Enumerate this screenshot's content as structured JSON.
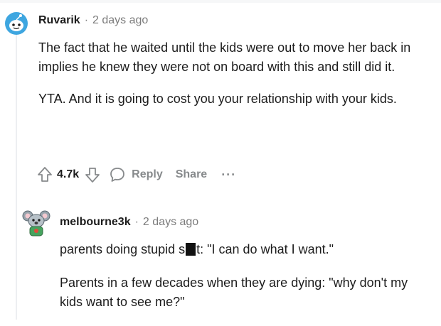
{
  "comments": [
    {
      "username": "Ruvarik",
      "timestamp": "2 days ago",
      "paragraphs": [
        "The fact that he waited until the kids were out to move her back in implies he knew they were not on board with this and still did it.",
        "YTA. And it is going to cost you your relationship with your kids."
      ],
      "vote_count": "4.7k",
      "actions": {
        "reply": "Reply",
        "share": "Share",
        "more": "···"
      },
      "avatar_icon": "snoo-avatar-icon",
      "avatar_color": "#3ea6e0"
    },
    {
      "username": "melbourne3k",
      "timestamp": "2 days ago",
      "paragraphs": [
        {
          "before": "parents doing stupid s",
          "after": "t: \"I can do what I want.\""
        },
        "Parents in a few decades when they are dying: \"why don't my kids want to see me?\""
      ],
      "avatar_icon": "snoo-koala-avatar-icon"
    }
  ],
  "separator": "·",
  "colors": {
    "meta": "#7c7c7c",
    "action": "#878a8c",
    "thread_line": "#edeff1",
    "text": "#1c1c1c"
  }
}
